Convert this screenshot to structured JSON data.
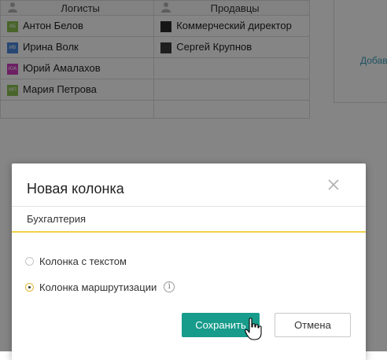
{
  "background": {
    "columns": [
      {
        "header": "Логисты"
      },
      {
        "header": "Продавцы"
      }
    ],
    "rows": [
      {
        "c1": {
          "name": "Антон Белов",
          "initials": "АБ",
          "color": "#8cc152"
        },
        "c2": {
          "name": "Коммерческий директор",
          "initials": "",
          "color": "#2b2b2b"
        }
      },
      {
        "c1": {
          "name": "Ирина Волк",
          "initials": "ИВ",
          "color": "#4a89dc"
        },
        "c2": {
          "name": "Сергей Крупнов",
          "initials": "",
          "color": "#3a3a3a"
        }
      },
      {
        "c1": {
          "name": "Юрий Амалахов",
          "initials": "ЮА",
          "color": "#d23cc0"
        },
        "c2": {
          "name": "",
          "initials": "",
          "color": ""
        }
      },
      {
        "c1": {
          "name": "Мария Петрова",
          "initials": "МП",
          "color": "#8cc152"
        },
        "c2": {
          "name": "",
          "initials": "",
          "color": ""
        }
      }
    ],
    "right_link": "Добав"
  },
  "modal": {
    "title": "Новая колонка",
    "name_value": "Бухгалтерия",
    "options": [
      {
        "label": "Колонка с текстом",
        "checked": false
      },
      {
        "label": "Колонка маршрутизации",
        "checked": true
      }
    ],
    "info_icon": "i",
    "save_label": "Сохранить",
    "cancel_label": "Отмена"
  },
  "colors": {
    "accent": "#179b8b",
    "underline": "#f0d14a",
    "radio_checked": "#e0b733",
    "link": "#3d9fbc"
  },
  "icons": [
    "person-icon",
    "close-icon",
    "info-icon",
    "hand-cursor-icon"
  ]
}
